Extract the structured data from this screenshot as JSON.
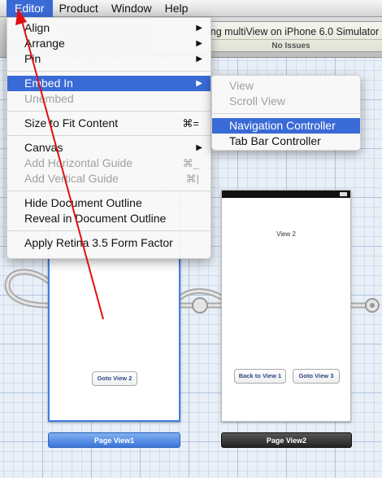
{
  "menubar": {
    "items": [
      {
        "label": "Editor",
        "active": true
      },
      {
        "label": "Product"
      },
      {
        "label": "Window"
      },
      {
        "label": "Help"
      }
    ]
  },
  "toolbar": {
    "activity_title": "ing multiView on iPhone 6.0 Simulator",
    "activity_status": "No Issues"
  },
  "editor_menu": {
    "group1": [
      {
        "label": "Align",
        "submenu": true
      },
      {
        "label": "Arrange",
        "submenu": true
      },
      {
        "label": "Pin",
        "submenu": true
      }
    ],
    "group2": [
      {
        "label": "Embed In",
        "submenu": true,
        "highlighted": true
      },
      {
        "label": "Unembed",
        "disabled": true
      }
    ],
    "group3": [
      {
        "label": "Size to Fit Content",
        "shortcut": "⌘="
      }
    ],
    "group4": [
      {
        "label": "Canvas",
        "submenu": true
      },
      {
        "label": "Add Horizontal Guide",
        "shortcut": "⌘_",
        "disabled": true
      },
      {
        "label": "Add Vertical Guide",
        "shortcut": "⌘|",
        "disabled": true
      }
    ],
    "group5": [
      {
        "label": "Hide Document Outline"
      },
      {
        "label": "Reveal in Document Outline"
      }
    ],
    "group6": [
      {
        "label": "Apply Retina 3.5 Form Factor"
      }
    ]
  },
  "embed_submenu": {
    "group1": [
      {
        "label": "View",
        "disabled": true
      },
      {
        "label": "Scroll View",
        "disabled": true
      }
    ],
    "group2": [
      {
        "label": "Navigation Controller",
        "highlighted": true
      },
      {
        "label": "Tab Bar Controller"
      }
    ]
  },
  "scenes": {
    "scene1": {
      "button": "Goto View 2",
      "label": "Page View1"
    },
    "scene2": {
      "title": "View 2",
      "button_back": "Back to View 1",
      "button_goto": "Goto View 3",
      "label": "Page View2"
    }
  },
  "colors": {
    "menu_highlight": "#3a6ad6",
    "annotation_arrow": "#e01010",
    "selection_border": "#3e7ee0"
  }
}
